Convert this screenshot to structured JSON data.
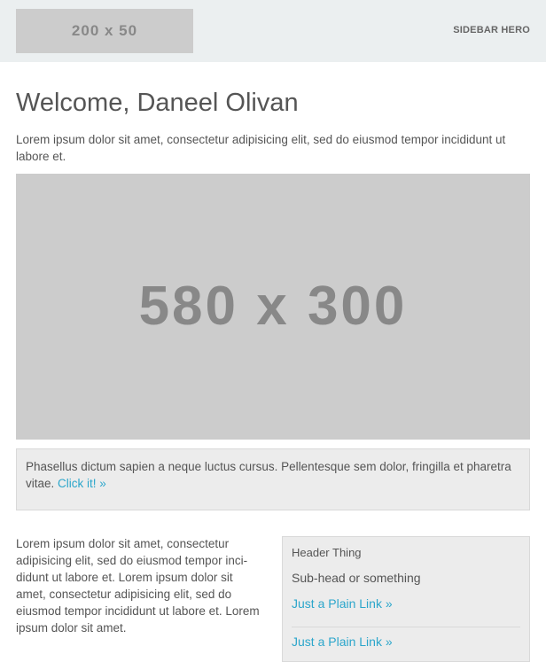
{
  "header": {
    "logo_text": "200 x 50",
    "hero_label": "SIDEBAR HERO"
  },
  "main": {
    "title": "Welcome, Daneel Olivan",
    "intro": "Lorem ipsum dolor sit amet, consectetur adipisicing elit, sed do eiusmod tempor incididunt ut labore et.",
    "hero_image_text": "580 x 300",
    "callout_text": "Phasellus dictum sapien a neque luctus cursus. Pellentesque sem dolor, fringilla et phare­tra vitae. ",
    "callout_link": "Click it! »",
    "body_text": "Lorem ipsum dolor sit amet, consectetur adipisicing elit, sed do eiusmod tempor inci­didunt ut labore et. Lorem ipsum dolor sit amet, consectetur adipisicing elit, sed do eiusmod tempor incididunt ut labore et. Lorem ipsum dolor sit amet."
  },
  "sidebar": {
    "header": "Header Thing",
    "subhead": "Sub-head or something",
    "link_1": "Just a Plain Link »",
    "link_2": "Just a Plain Link »"
  },
  "colors": {
    "header_bg": "#ebeff0",
    "placeholder_bg": "#cccccc",
    "link": "#2ba6cb",
    "panel_bg": "#ececec"
  }
}
